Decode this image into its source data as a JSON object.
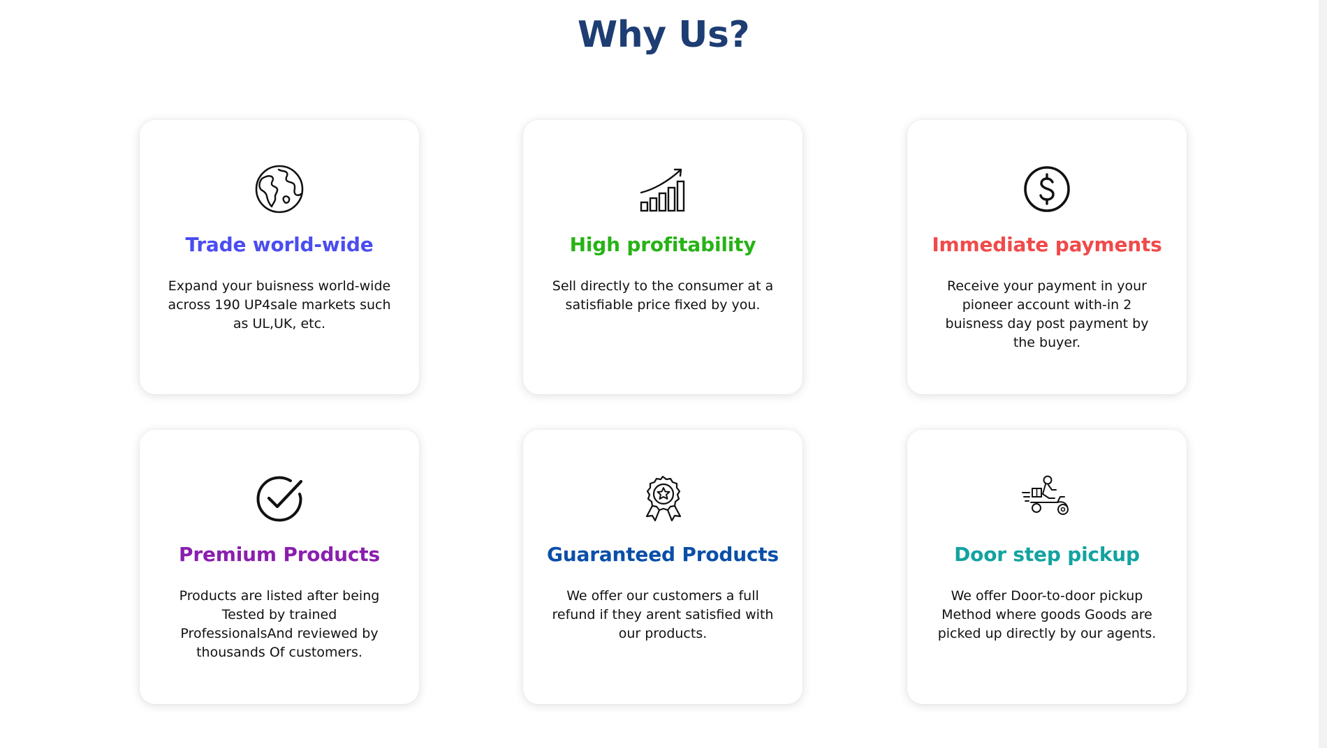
{
  "section": {
    "title": "Why Us?"
  },
  "cards": [
    {
      "icon": "globe-icon",
      "title": "Trade world-wide",
      "title_color": "#4a4df0",
      "description": "Expand your buisness world-wide across 190 UP4sale markets such as UL,UK, etc."
    },
    {
      "icon": "growth-chart-icon",
      "title": "High profitability",
      "title_color": "#27b316",
      "description": "Sell directly to the consumer at a satisfiable price fixed by you."
    },
    {
      "icon": "dollar-coin-icon",
      "title": "Immediate payments",
      "title_color": "#f04a4a",
      "description": "Receive your payment in your pioneer account with-in 2 buisness day post payment by the buyer."
    },
    {
      "icon": "checkmark-circle-icon",
      "title": "Premium Products",
      "title_color": "#8a1fae",
      "description": "Products are listed after being Tested by trained ProfessionalsAnd reviewed by thousands Of customers."
    },
    {
      "icon": "award-badge-icon",
      "title": "Guaranteed Products",
      "title_color": "#0a4fa8",
      "description": "We offer our customers a full refund if they arent satisfied with our products."
    },
    {
      "icon": "delivery-scooter-icon",
      "title": "Door step pickup",
      "title_color": "#13a3a0",
      "description": "We offer Door-to-door pickup Method where goods Goods are picked up directly by our agents."
    }
  ]
}
